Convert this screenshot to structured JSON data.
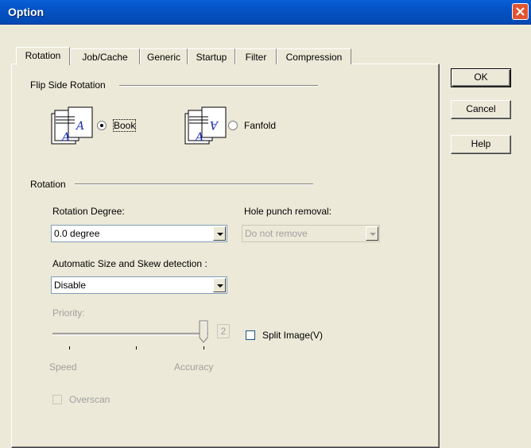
{
  "window": {
    "title": "Option"
  },
  "tabs": [
    {
      "label": "Rotation",
      "active": true
    },
    {
      "label": "Job/Cache"
    },
    {
      "label": "Generic"
    },
    {
      "label": "Startup"
    },
    {
      "label": "Filter"
    },
    {
      "label": "Compression"
    }
  ],
  "flip_side": {
    "heading": "Flip Side Rotation",
    "options": [
      {
        "label": "Book",
        "selected": true,
        "icon": "book-pages-icon"
      },
      {
        "label": "Fanfold",
        "selected": false,
        "icon": "fanfold-pages-icon"
      }
    ]
  },
  "rotation": {
    "heading": "Rotation",
    "degree_label": "Rotation Degree:",
    "degree_value": "0.0 degree",
    "hole_label": "Hole punch removal:",
    "hole_value": "Do not remove",
    "auto_label": "Automatic Size and Skew detection :",
    "auto_value": "Disable",
    "priority_label": "Priority:",
    "priority_value": "2",
    "speed_label": "Speed",
    "accuracy_label": "Accuracy",
    "split_label": "Split Image(V)",
    "overscan_label": "Overscan"
  },
  "buttons": {
    "ok": "OK",
    "cancel": "Cancel",
    "help": "Help"
  }
}
